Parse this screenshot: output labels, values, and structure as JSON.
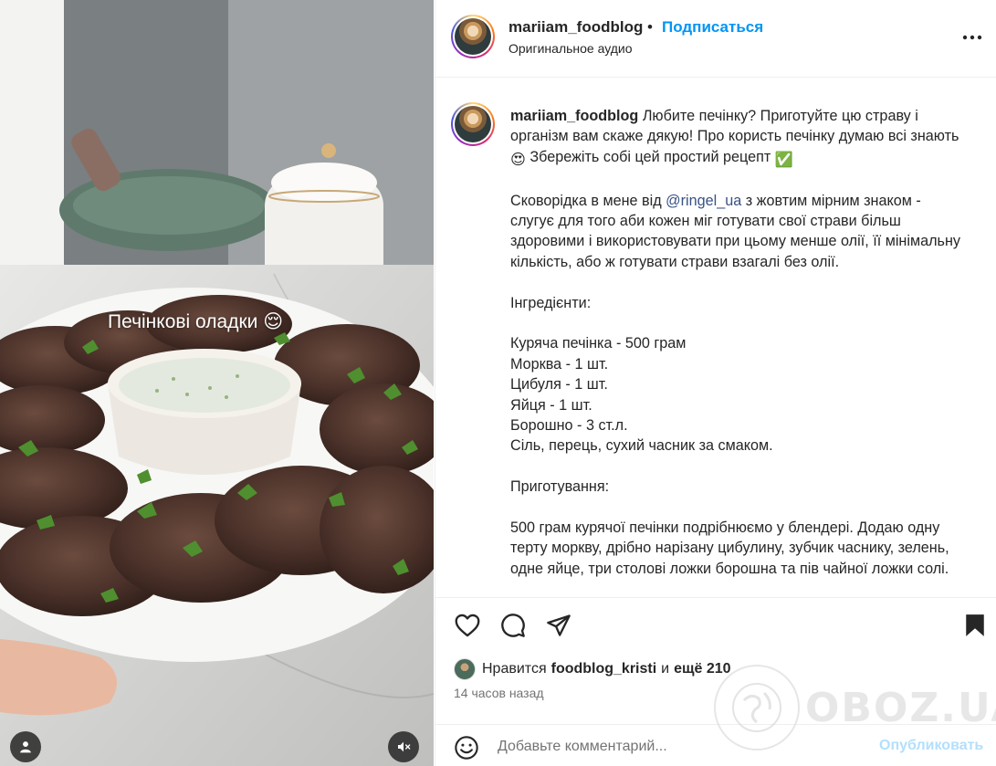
{
  "media": {
    "overlay_text": "Печінкові оладки 😌",
    "user_icon": "user-icon",
    "mute_icon": "sound-off-icon"
  },
  "header": {
    "username": "mariiam_foodblog",
    "separator": "•",
    "follow_label": "Подписаться",
    "audio_label": "Оригинальное аудио",
    "more_icon": "more-horizontal-icon"
  },
  "caption": {
    "username": "mariiam_foodblog",
    "intro": "Любите печінку? Приготуйте цю страву і організм вам скаже дякую! Про користь печінку думаю всі знають",
    "emoji_1": "😍",
    "intro_end": "Збережіть собі цей простий рецепт",
    "emoji_2": "✅",
    "para2_before": "Сковорідка в мене від ",
    "mention": "@ringel_ua",
    "para2_after": " з жовтим мірним знаком - слугує для того аби кожен міг готувати свої страви більш здоровими і використовувати при цьому менше олії, її мінімальну кількість, або ж готувати страви взагалі без олії.",
    "ingredients_title": "Інгредієнти:",
    "ingredients": [
      "Куряча печінка - 500 грам",
      "Морква - 1 шт.",
      "Цибуля - 1 шт.",
      "Яйця - 1 шт.",
      "Борошно - 3 ст.л.",
      "Сіль, перець, сухий часник за смаком."
    ],
    "method_title": "Приготування:",
    "method_text": "500 грам курячої печінки подрібнюємо у блендері. Додаю одну терту моркву, дрібно нарізану цибулину, зубчик часнику, зелень, одне яйце, три столові ложки борошна та пів чайної ложки солі."
  },
  "actions": {
    "like_icon": "heart-icon",
    "comment_icon": "comment-icon",
    "share_icon": "share-icon",
    "save_icon": "bookmark-icon"
  },
  "likes": {
    "prefix": "Нравится",
    "user": "foodblog_kristi",
    "conjunction": "и",
    "others": "ещё 210"
  },
  "time_ago": "14 часов назад",
  "comment_bar": {
    "placeholder": "Добавьте комментарий...",
    "publish_label": "Опубликовать",
    "emoji_icon": "smile-icon"
  },
  "watermark": {
    "text": "OBOZ.UA"
  },
  "colors": {
    "accent": "#0095f6",
    "mention": "#385185",
    "publish_disabled": "#b2dffc",
    "text": "#262626",
    "muted": "#737373"
  }
}
